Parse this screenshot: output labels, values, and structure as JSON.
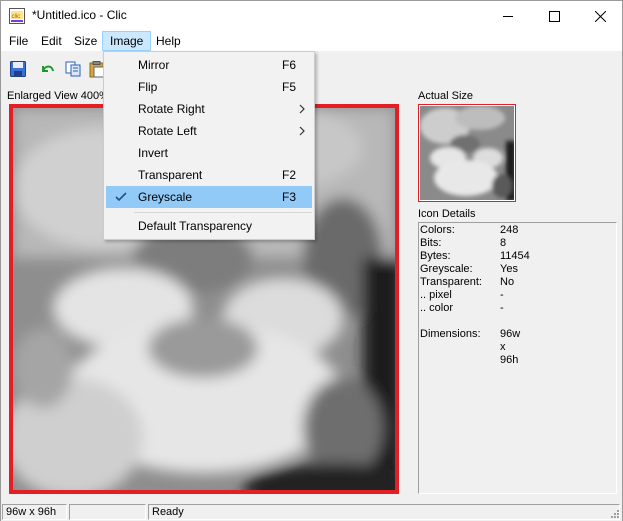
{
  "window": {
    "title": "*Untitled.ico - Clic",
    "controls": {
      "minimize": "minimize",
      "maximize": "maximize",
      "close": "close"
    }
  },
  "menubar": {
    "items": [
      {
        "label": "File"
      },
      {
        "label": "Edit"
      },
      {
        "label": "Size"
      },
      {
        "label": "Image"
      },
      {
        "label": "Help"
      }
    ],
    "active": "Image"
  },
  "toolbar": {
    "buttons": [
      "save-icon",
      "undo-icon",
      "copy-icon",
      "paste-icon"
    ]
  },
  "image_menu": {
    "items": [
      {
        "label": "Mirror",
        "shortcut": "F6",
        "submenu": false,
        "checked": false
      },
      {
        "label": "Flip",
        "shortcut": "F5",
        "submenu": false,
        "checked": false
      },
      {
        "label": "Rotate Right",
        "shortcut": "",
        "submenu": true,
        "checked": false
      },
      {
        "label": "Rotate Left",
        "shortcut": "",
        "submenu": true,
        "checked": false
      },
      {
        "label": "Invert",
        "shortcut": "",
        "submenu": false,
        "checked": false
      },
      {
        "label": "Transparent",
        "shortcut": "F2",
        "submenu": false,
        "checked": false
      },
      {
        "label": "Greyscale",
        "shortcut": "F3",
        "submenu": false,
        "checked": true,
        "highlighted": true
      }
    ],
    "after_separator": {
      "label": "Default Transparency"
    }
  },
  "enlarged_view": {
    "label": "Enlarged View 400%",
    "border_color": "#e31e24"
  },
  "actual_size": {
    "label": "Actual Size"
  },
  "icon_details": {
    "label": "Icon Details",
    "rows": [
      {
        "key": "Colors:",
        "value": "248"
      },
      {
        "key": "Bits:",
        "value": "8"
      },
      {
        "key": "Bytes:",
        "value": "11454"
      },
      {
        "key": "Greyscale:",
        "value": "Yes"
      },
      {
        "key": "Transparent:",
        "value": "No"
      },
      {
        "key": ".. pixel",
        "value": "-"
      },
      {
        "key": ".. color",
        "value": "-"
      },
      {
        "key": "",
        "value": ""
      },
      {
        "key": "Dimensions:",
        "value": "96w x 96h"
      }
    ]
  },
  "statusbar": {
    "dimensions": "96w x 96h",
    "middle": "",
    "status": "Ready"
  },
  "colors": {
    "accent_red": "#e31e24",
    "menu_highlight": "#91c9f7",
    "menubar_active": "#cce8ff"
  }
}
